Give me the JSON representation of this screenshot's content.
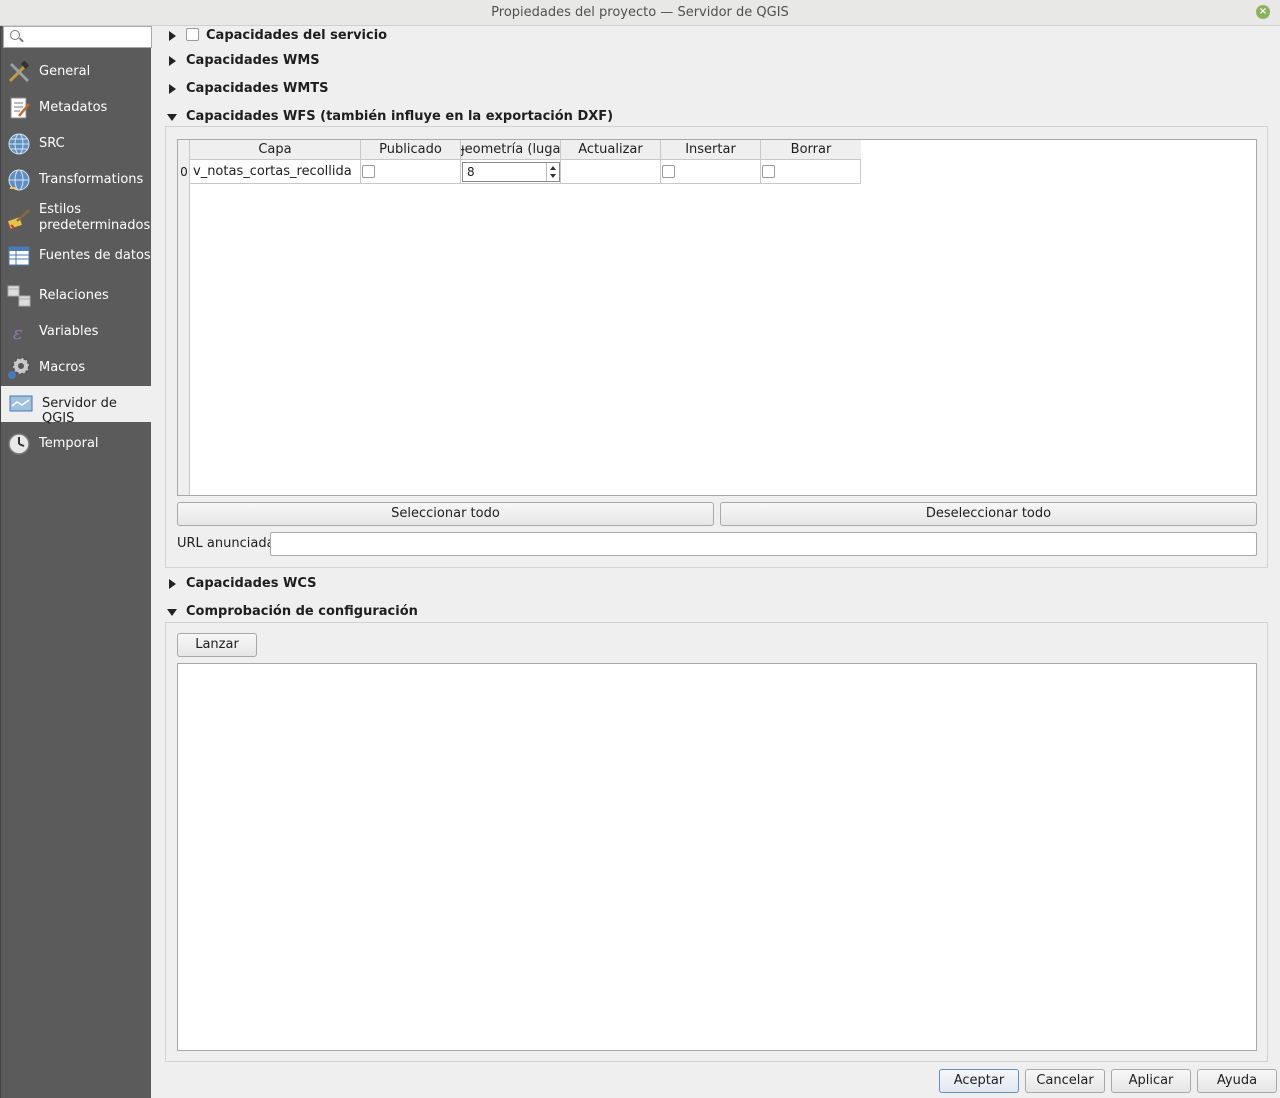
{
  "window": {
    "title": "Propiedades del proyecto — Servidor de QGIS"
  },
  "search": {
    "placeholder": ""
  },
  "sidebar": {
    "items": [
      {
        "label": "General",
        "icon": "tools-icon"
      },
      {
        "label": "Metadatos",
        "icon": "metadata-icon"
      },
      {
        "label": "SRC",
        "icon": "globe-icon"
      },
      {
        "label": "Transformations",
        "icon": "globe-transform-icon"
      },
      {
        "label": "Estilos\npredeterminados",
        "icon": "brush-icon"
      },
      {
        "label": "Fuentes de datos",
        "icon": "table-icon"
      },
      {
        "label": "Relaciones",
        "icon": "relations-icon"
      },
      {
        "label": "Variables",
        "icon": "variable-icon"
      },
      {
        "label": "Macros",
        "icon": "gear-icon"
      },
      {
        "label": "Servidor de QGIS",
        "icon": "server-map-icon"
      },
      {
        "label": "Temporal",
        "icon": "clock-icon"
      }
    ],
    "active_index": 9
  },
  "sections": {
    "service": "Capacidades del servicio",
    "wms": "Capacidades WMS",
    "wmts": "Capacidades WMTS",
    "wfs": "Capacidades WFS (también influye en la exportación DXF)",
    "wcs": "Capacidades WCS",
    "config": "Comprobación de configuración"
  },
  "wfs": {
    "columns": [
      "Capa",
      "Publicado",
      "ɟeometría (lugar",
      "Actualizar",
      "Insertar",
      "Borrar"
    ],
    "rows": [
      {
        "num": "0",
        "layer": "v_notas_cortas_recollida",
        "published": false,
        "precision": "8",
        "update": "",
        "insert": false,
        "delete": false
      }
    ],
    "select_all": "Seleccionar todo",
    "deselect_all": "Deseleccionar todo",
    "url_label": "URL anunciada",
    "url_value": ""
  },
  "config": {
    "launch": "Lanzar"
  },
  "footer": {
    "ok": "Aceptar",
    "cancel": "Cancelar",
    "apply": "Aplicar",
    "help": "Ayuda"
  },
  "colors": {
    "sidebar_bg": "#5b5b5b",
    "active_bg": "#efefef",
    "close_button": "#8bb35b",
    "default_button_border": "#6a8cb8"
  }
}
